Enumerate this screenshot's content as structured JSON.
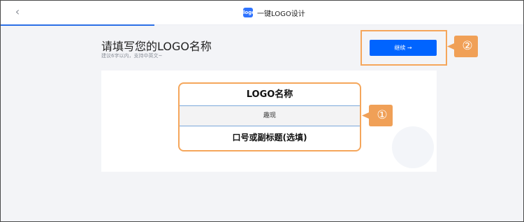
{
  "header": {
    "back_icon": "chevron-left-icon",
    "brand_logo_text": "logo",
    "brand_title": "一键LOGO设计"
  },
  "main": {
    "title": "请填写您的LOGO名称",
    "subtitle": "建议6字以内，支持中英文~",
    "continue_label": "继续 →"
  },
  "form": {
    "name_label": "LOGO名称",
    "name_value": "趣现",
    "slogan_label": "口号或副标题(选填)"
  },
  "annotations": {
    "marker_1": "①",
    "marker_2": "②",
    "highlight_color": "#f5a65b"
  },
  "colors": {
    "accent": "#0064ff",
    "progress": "#2b6fe6"
  }
}
